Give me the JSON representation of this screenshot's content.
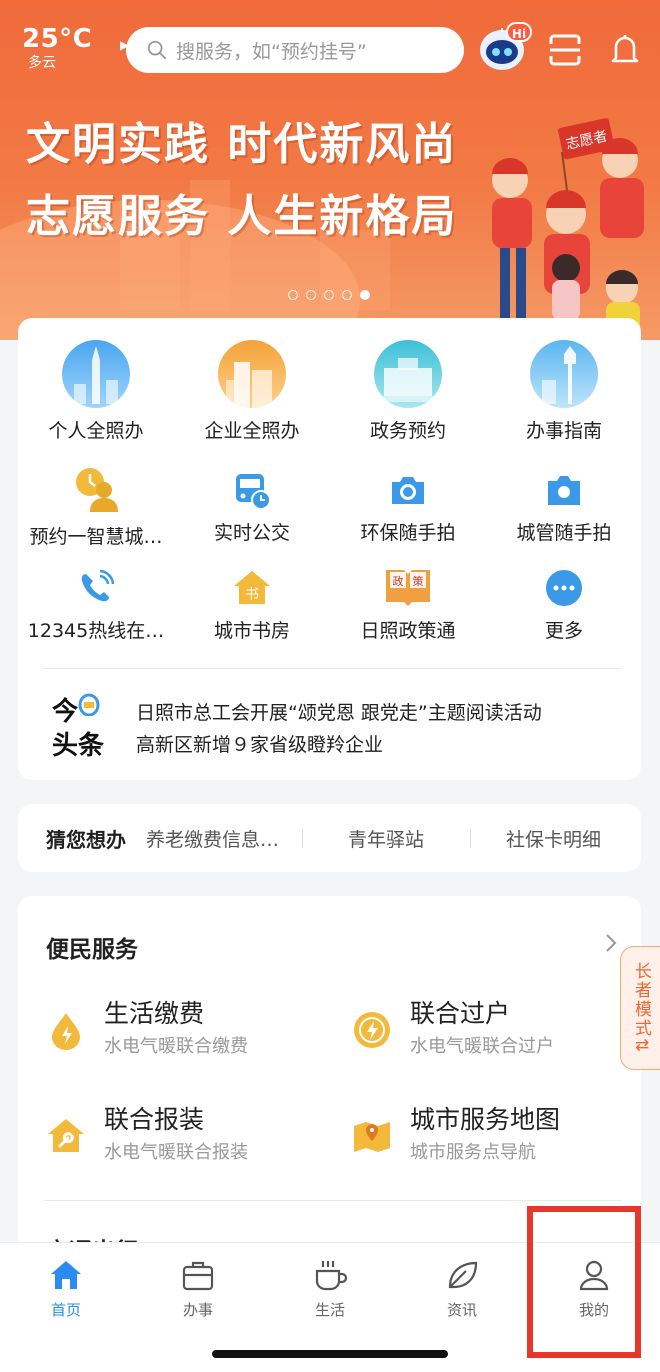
{
  "weather": {
    "temp": "25°C",
    "desc": "多云"
  },
  "search": {
    "placeholder": "搜服务，如“预约挂号”"
  },
  "robot": {
    "badge": "Hi"
  },
  "banner": {
    "line1": "文明实践 时代新风尚",
    "line2": "志愿服务 人生新格局",
    "flag_text": "志愿者",
    "slide_count": 5,
    "active_slide": 5
  },
  "services": [
    {
      "label": "个人全照办",
      "icon": "personal-service-icon"
    },
    {
      "label": "企业全照办",
      "icon": "enterprise-service-icon"
    },
    {
      "label": "政务预约",
      "icon": "gov-appointment-icon"
    },
    {
      "label": "办事指南",
      "icon": "service-guide-icon"
    },
    {
      "label": "预约一智慧城…",
      "icon": "smart-city-appointment-icon"
    },
    {
      "label": "实时公交",
      "icon": "bus-icon"
    },
    {
      "label": "环保随手拍",
      "icon": "camera-icon"
    },
    {
      "label": "城管随手拍",
      "icon": "camera-icon"
    },
    {
      "label": "12345热线在…",
      "icon": "phone-icon"
    },
    {
      "label": "城市书房",
      "icon": "book-house-icon"
    },
    {
      "label": "日照政策通",
      "icon": "policy-book-icon"
    },
    {
      "label": "更多",
      "icon": "more-icon"
    }
  ],
  "headlines": {
    "logo_top": "今",
    "logo_bottom": "头条",
    "items": [
      "日照市总工会开展“颂党恩 跟党走”主题阅读活动",
      "高新区新增９家省级瞪羚企业"
    ]
  },
  "guess": {
    "title": "猜您想办",
    "options": [
      "养老缴费信息…",
      "青年驿站",
      "社保卡明细"
    ]
  },
  "convenience": {
    "title": "便民服务",
    "items": [
      {
        "name": "生活缴费",
        "desc": "水电气暖联合缴费",
        "icon": "drop-icon"
      },
      {
        "name": "联合过户",
        "desc": "水电气暖联合过户",
        "icon": "lightning-icon"
      },
      {
        "name": "联合报装",
        "desc": "水电气暖联合报装",
        "icon": "house-wrench-icon"
      },
      {
        "name": "城市服务地图",
        "desc": "城市服务点导航",
        "icon": "map-icon"
      }
    ],
    "next_section": "交通出行"
  },
  "elder_mode": "长者模式⇅",
  "tabs": [
    {
      "label": "首页",
      "icon": "home-icon",
      "active": true
    },
    {
      "label": "办事",
      "icon": "briefcase-icon",
      "active": false
    },
    {
      "label": "生活",
      "icon": "cup-icon",
      "active": false
    },
    {
      "label": "资讯",
      "icon": "leaf-icon",
      "active": false
    },
    {
      "label": "我的",
      "icon": "user-icon",
      "active": false
    }
  ],
  "colors": {
    "brand_orange": "#f06a3a",
    "tab_active": "#2a8cf0",
    "icon_yellow": "#f2b93b",
    "icon_blue": "#3b9ae8",
    "highlight": "#e5382a"
  }
}
